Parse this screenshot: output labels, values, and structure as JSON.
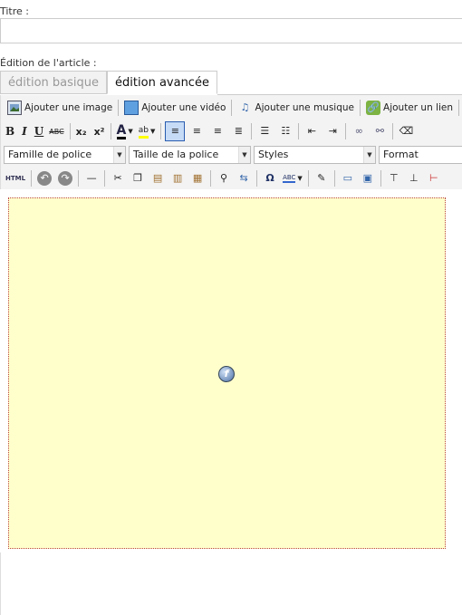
{
  "form": {
    "title_label": "Titre :",
    "title_value": "",
    "edition_label": "Édition de l'article :"
  },
  "tabs": [
    {
      "label": "édition basique",
      "active": false
    },
    {
      "label": "édition avancée",
      "active": true
    }
  ],
  "media_buttons": {
    "add_image": "Ajouter une image",
    "add_video": "Ajouter une vidéo",
    "add_music": "Ajouter une musique",
    "add_link": "Ajouter un lien"
  },
  "format_buttons": {
    "bold": "B",
    "italic": "I",
    "underline": "U",
    "strike": "ABC",
    "subscript": "x₂",
    "superscript": "x²",
    "text_color": "A",
    "highlight": "ab"
  },
  "selects": {
    "font_family": "Famille de police",
    "font_size": "Taille de la police",
    "styles": "Styles",
    "format": "Format"
  },
  "row3": {
    "html": "HTML",
    "omega": "Ω",
    "spell": "ABC"
  },
  "colors": {
    "editor_bg": "#ffffcc",
    "toolbar_bg": "#f3f3f3"
  }
}
